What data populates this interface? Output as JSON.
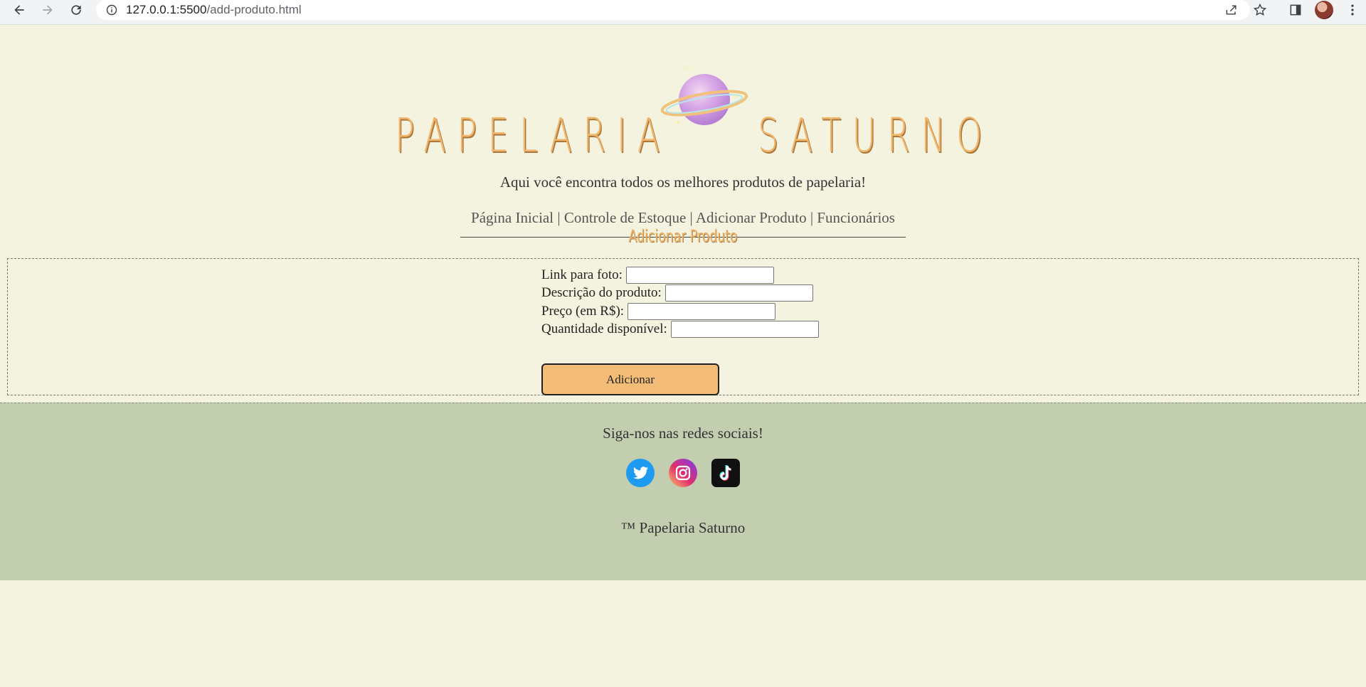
{
  "browser": {
    "url_host": "127.0.0.1:5500",
    "url_path": "/add-produto.html",
    "icons": [
      "back-icon",
      "forward-icon",
      "reload-icon",
      "info-icon",
      "share-icon",
      "star-icon",
      "sidebar-icon",
      "avatar",
      "menu-icon"
    ]
  },
  "header": {
    "logo_word_1": "PAPELARIA",
    "logo_word_2": "SATURNO",
    "tagline": "Aqui você encontra todos os melhores produtos de papelaria!",
    "nav": [
      {
        "label": "Página Inicial"
      },
      {
        "label": "Controle de Estoque"
      },
      {
        "label": "Adicionar Produto"
      },
      {
        "label": "Funcionários"
      }
    ],
    "separator": "|"
  },
  "main": {
    "title": "Adicionar Produto",
    "fields": [
      {
        "label": "Link para foto:",
        "value": ""
      },
      {
        "label": "Descrição do produto:",
        "value": ""
      },
      {
        "label": "Preço (em R$):",
        "value": ""
      },
      {
        "label": "Quantidade disponível:",
        "value": ""
      }
    ],
    "submit_label": "Adicionar"
  },
  "footer": {
    "follow": "Siga-nos nas redes sociais!",
    "socials": [
      "twitter-icon",
      "instagram-icon",
      "tiktok-icon"
    ],
    "copyright": "™ Papelaria Saturno"
  },
  "colors": {
    "page_bg": "#f3f3df",
    "accent": "#f0b56b",
    "button_bg": "#f3bd77",
    "footer_bg": "#c3cdb0"
  }
}
